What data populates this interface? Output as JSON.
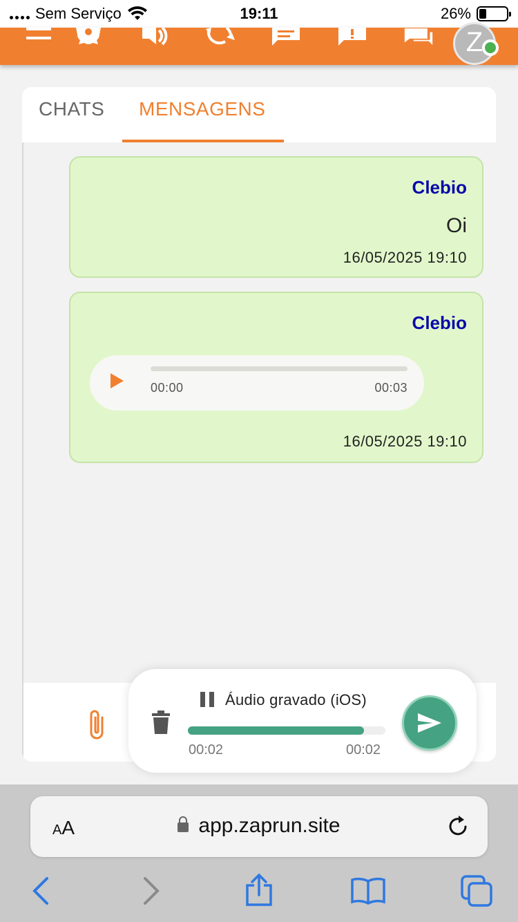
{
  "status_bar": {
    "carrier": "Sem Serviço",
    "time": "19:11",
    "battery": "26%",
    "battery_level": 0.26
  },
  "toolbar": {
    "icons": [
      "menu-icon",
      "settings-gear-icon",
      "volume-icon",
      "sync-icon",
      "chat-icon",
      "alert-message-icon",
      "conversations-icon"
    ],
    "avatar_initial": "Z",
    "accent_color": "#f08030",
    "online_color": "#4caf50"
  },
  "tabs": [
    {
      "label": "CHATS",
      "active": false
    },
    {
      "label": "MENSAGENS",
      "active": true
    }
  ],
  "messages": [
    {
      "sender": "Clebio",
      "text": "Oi",
      "timestamp": "16/05/2025 19:10"
    },
    {
      "sender": "Clebio",
      "audio": {
        "current": "00:00",
        "duration": "00:03",
        "progress": 0
      },
      "timestamp": "16/05/2025 19:10"
    }
  ],
  "recorder": {
    "label": "Áudio gravado (iOS)",
    "current": "00:02",
    "duration": "00:02",
    "progress": 0.89,
    "color": "#45a283"
  },
  "browser": {
    "text_size_label": "AA",
    "url": "app.zaprun.site"
  }
}
